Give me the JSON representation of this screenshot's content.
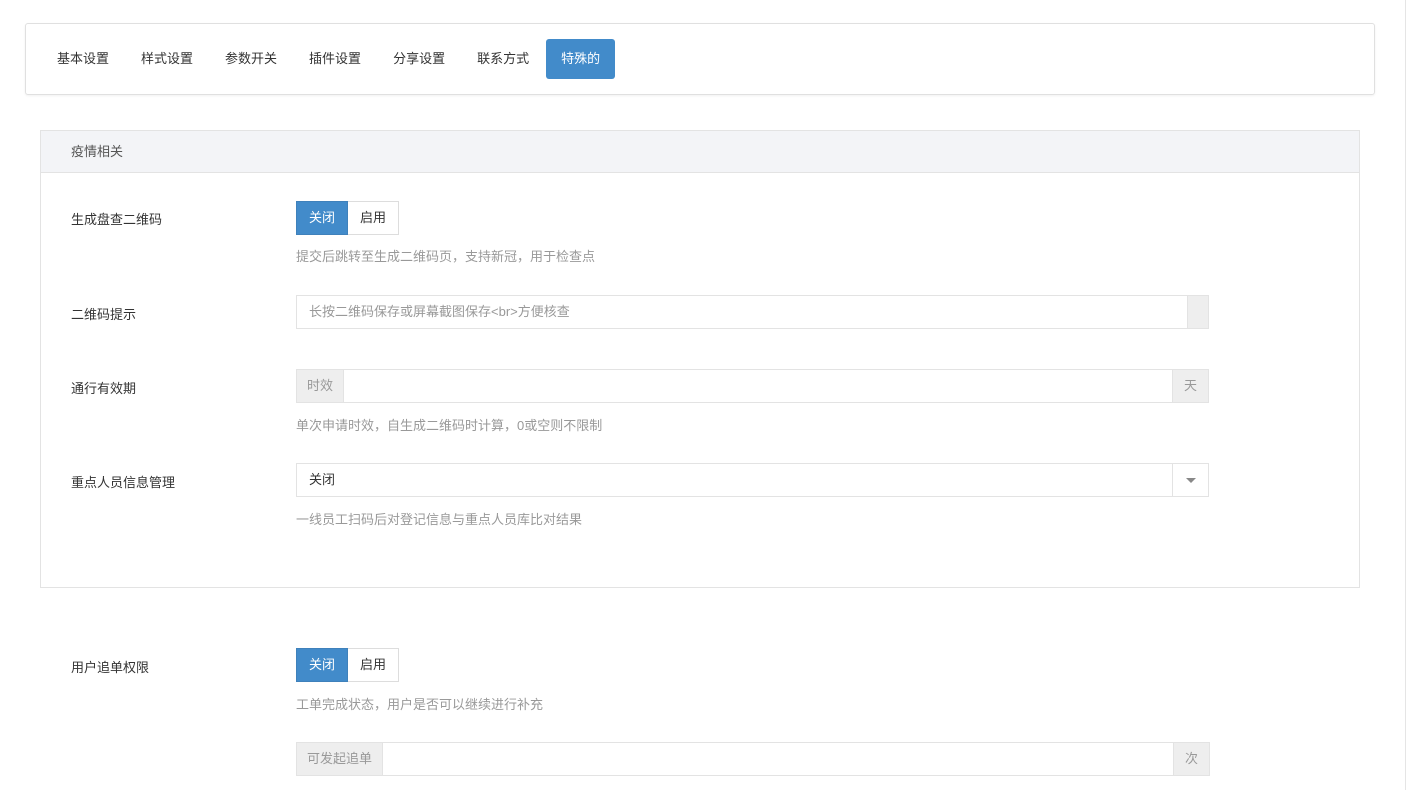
{
  "tabs": [
    "基本设置",
    "样式设置",
    "参数开关",
    "插件设置",
    "分享设置",
    "联系方式",
    "特殊的"
  ],
  "panel": {
    "title": "疫情相关",
    "qr_generate": {
      "label": "生成盘查二维码",
      "off": "关闭",
      "on": "启用",
      "help": "提交后跳转至生成二维码页，支持新冠，用于检查点"
    },
    "qr_hint": {
      "label": "二维码提示",
      "placeholder": "长按二维码保存或屏幕截图保存<br>方便核查"
    },
    "validity": {
      "label": "通行有效期",
      "prefix": "时效",
      "value": "",
      "suffix": "天",
      "help": "单次申请时效，自生成二维码时计算，0或空则不限制"
    },
    "key_person": {
      "label": "重点人员信息管理",
      "selected": "关闭",
      "help": "一线员工扫码后对登记信息与重点人员库比对结果"
    }
  },
  "followup": {
    "label": "用户追单权限",
    "off": "关闭",
    "on": "启用",
    "help": "工单完成状态，用户是否可以继续进行补充",
    "prefix": "可发起追单",
    "value": "",
    "suffix": "次"
  }
}
